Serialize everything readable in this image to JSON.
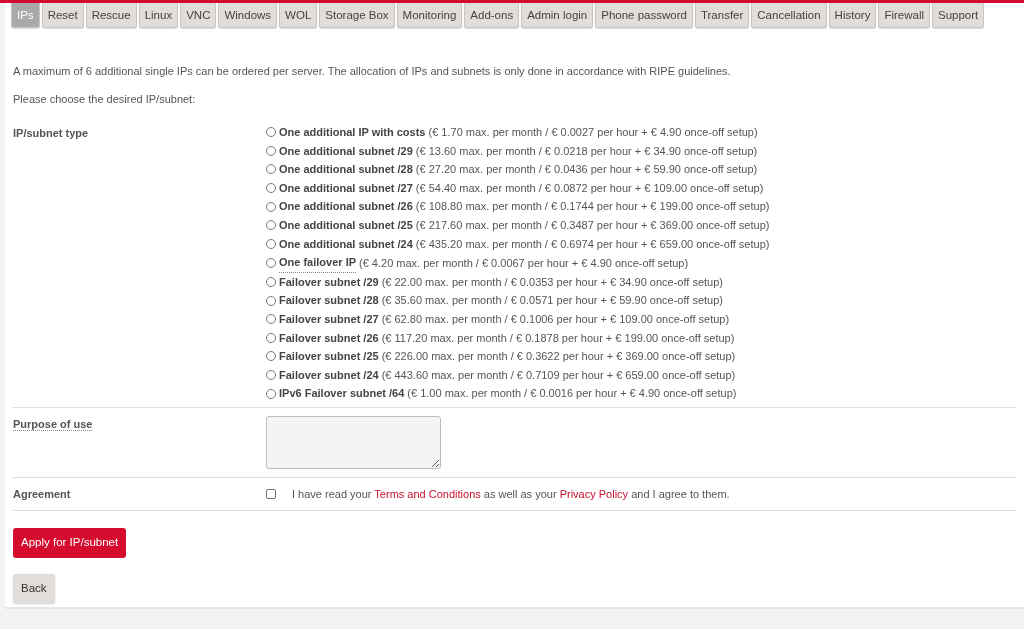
{
  "tabs": [
    {
      "label": "IPs",
      "selected": true
    },
    {
      "label": "Reset",
      "selected": false
    },
    {
      "label": "Rescue",
      "selected": false
    },
    {
      "label": "Linux",
      "selected": false
    },
    {
      "label": "VNC",
      "selected": false
    },
    {
      "label": "Windows",
      "selected": false
    },
    {
      "label": "WOL",
      "selected": false
    },
    {
      "label": "Storage Box",
      "selected": false
    },
    {
      "label": "Monitoring",
      "selected": false
    },
    {
      "label": "Add-ons",
      "selected": false
    },
    {
      "label": "Admin login",
      "selected": false
    },
    {
      "label": "Phone password",
      "selected": false
    },
    {
      "label": "Transfer",
      "selected": false
    },
    {
      "label": "Cancellation",
      "selected": false
    },
    {
      "label": "History",
      "selected": false
    },
    {
      "label": "Firewall",
      "selected": false
    },
    {
      "label": "Support",
      "selected": false
    }
  ],
  "intro": [
    "A maximum of 6 additional single IPs can be ordered per server. The allocation of IPs and subnets is only done in accordance with RIPE guidelines.",
    "Please choose the desired IP/subnet:"
  ],
  "ip_type": {
    "label": "IP/subnet type",
    "options": [
      {
        "name": "One additional IP with costs",
        "price": "(€ 1.70 max. per month / € 0.0027 per hour + € 4.90 once-off setup)",
        "selected": false,
        "tooltip": false
      },
      {
        "name": "One additional subnet /29",
        "price": "(€ 13.60 max. per month / € 0.0218 per hour + € 34.90 once-off setup)",
        "selected": false,
        "tooltip": false
      },
      {
        "name": "One additional subnet /28",
        "price": "(€ 27.20 max. per month / € 0.0436 per hour + € 59.90 once-off setup)",
        "selected": false,
        "tooltip": false
      },
      {
        "name": "One additional subnet /27",
        "price": "(€ 54.40 max. per month / € 0.0872 per hour + € 109.00 once-off setup)",
        "selected": false,
        "tooltip": false
      },
      {
        "name": "One additional subnet /26",
        "price": "(€ 108.80 max. per month / € 0.1744 per hour + € 199.00 once-off setup)",
        "selected": false,
        "tooltip": false
      },
      {
        "name": "One additional subnet /25",
        "price": "(€ 217.60 max. per month / € 0.3487 per hour + € 369.00 once-off setup)",
        "selected": false,
        "tooltip": false
      },
      {
        "name": "One additional subnet /24",
        "price": "(€ 435.20 max. per month / € 0.6974 per hour + € 659.00 once-off setup)",
        "selected": false,
        "tooltip": false
      },
      {
        "name": "One failover IP",
        "price": "(€ 4.20 max. per month / € 0.0067 per hour + € 4.90 once-off setup)",
        "selected": false,
        "tooltip": true
      },
      {
        "name": "Failover subnet /29",
        "price": "(€ 22.00 max. per month / € 0.0353 per hour + € 34.90 once-off setup)",
        "selected": false,
        "tooltip": false
      },
      {
        "name": "Failover subnet /28",
        "price": "(€ 35.60 max. per month / € 0.0571 per hour + € 59.90 once-off setup)",
        "selected": false,
        "tooltip": false
      },
      {
        "name": "Failover subnet /27",
        "price": "(€ 62.80 max. per month / € 0.1006 per hour + € 109.00 once-off setup)",
        "selected": false,
        "tooltip": false
      },
      {
        "name": "Failover subnet /26",
        "price": "(€ 117.20 max. per month / € 0.1878 per hour + € 199.00 once-off setup)",
        "selected": false,
        "tooltip": false
      },
      {
        "name": "Failover subnet /25",
        "price": "(€ 226.00 max. per month / € 0.3622 per hour + € 369.00 once-off setup)",
        "selected": false,
        "tooltip": false
      },
      {
        "name": "Failover subnet /24",
        "price": "(€ 443.60 max. per month / € 0.7109 per hour + € 659.00 once-off setup)",
        "selected": false,
        "tooltip": false
      },
      {
        "name": "IPv6 Failover subnet /64",
        "price": "(€ 1.00 max. per month / € 0.0016 per hour + € 4.90 once-off setup)",
        "selected": false,
        "tooltip": false
      }
    ]
  },
  "purpose": {
    "label": "Purpose of use",
    "tooltip": true
  },
  "agreement": {
    "label": "Agreement",
    "checked": false,
    "parts": [
      {
        "kind": "text",
        "text": "I have read your"
      },
      {
        "kind": "link",
        "text": "Terms and Conditions"
      },
      {
        "kind": "text",
        "text": "as well as your"
      },
      {
        "kind": "link",
        "text": "Privacy Policy"
      },
      {
        "kind": "text",
        "text": "and I agree to them."
      }
    ]
  },
  "apply_button": "Apply for IP/subnet",
  "back_button": "Back"
}
